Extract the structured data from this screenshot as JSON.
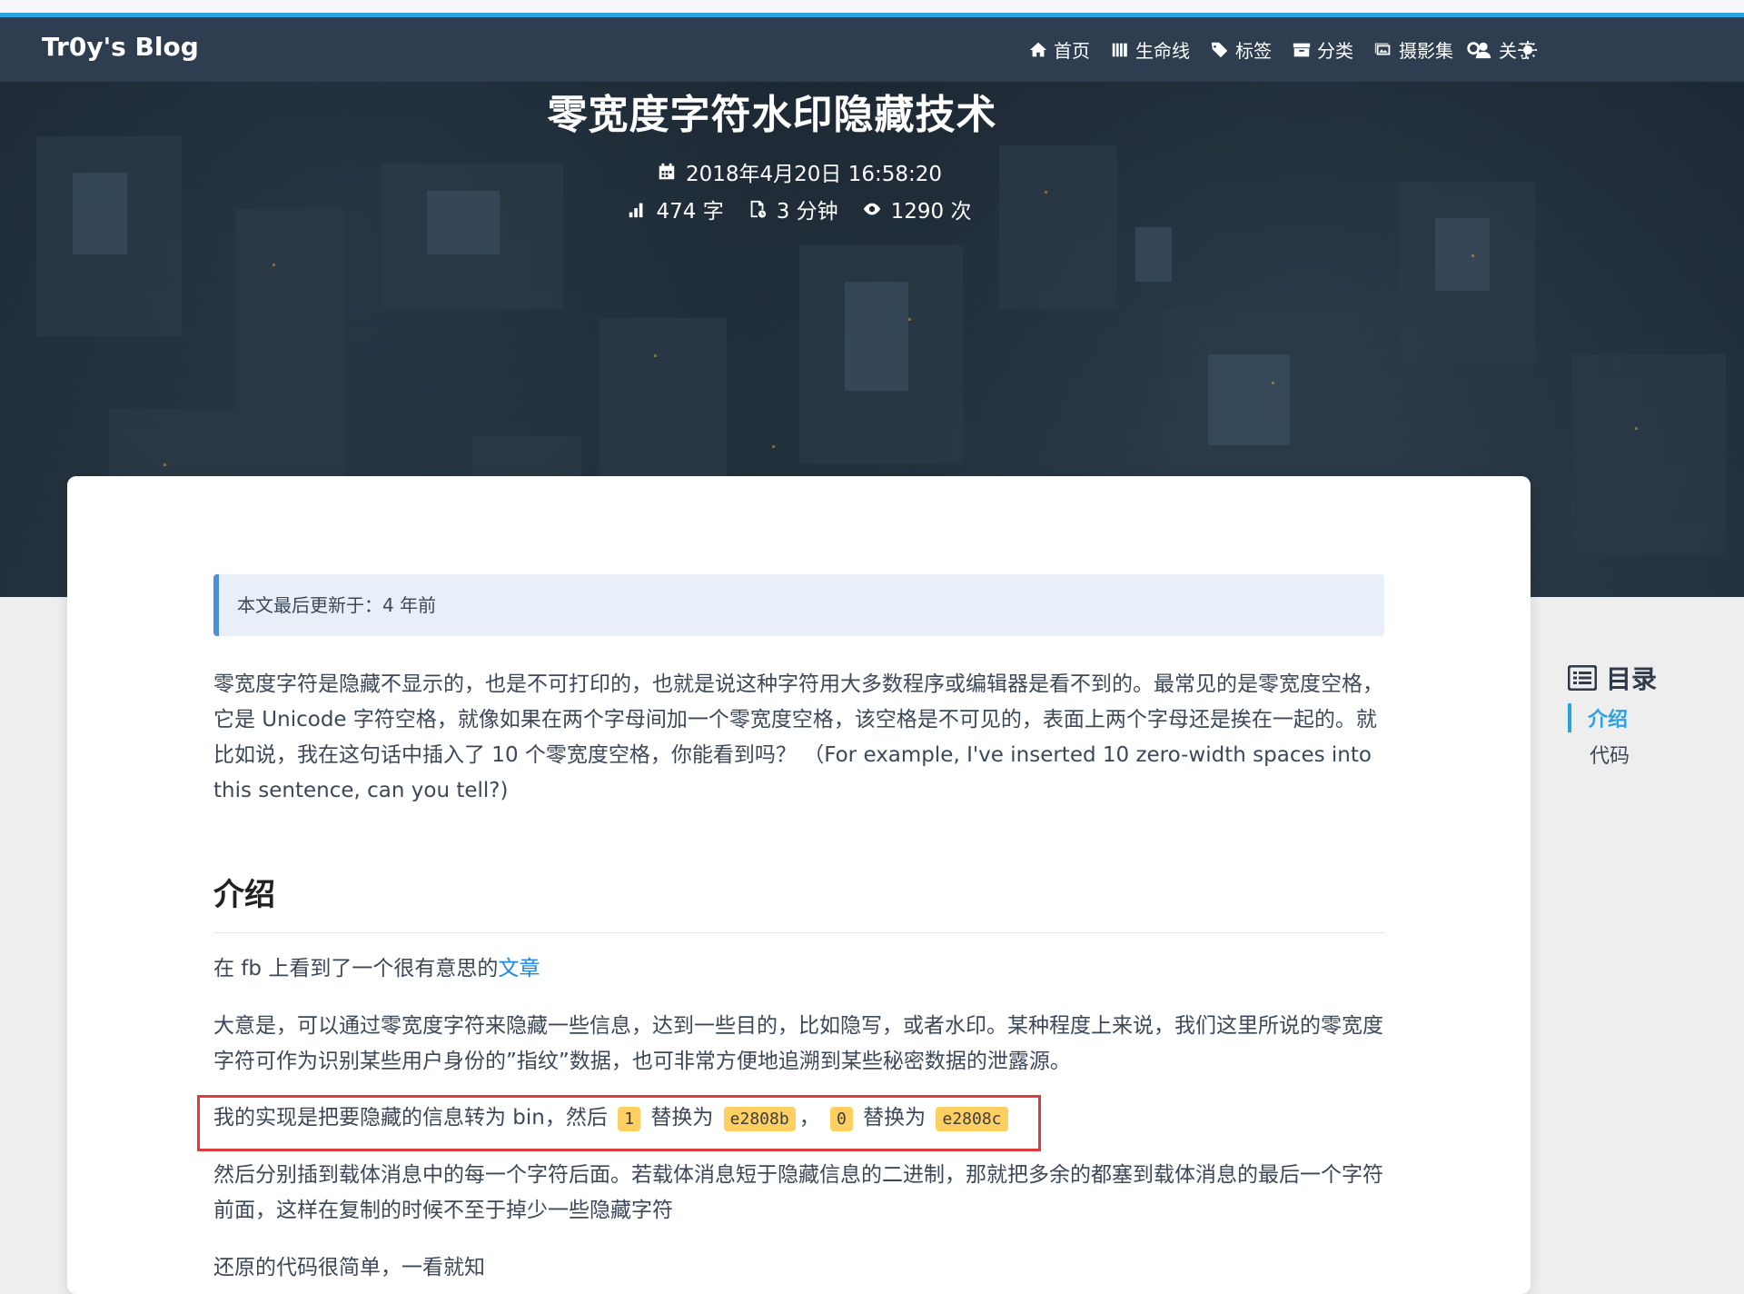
{
  "navbar": {
    "brand": "Tr0y's Blog",
    "items": [
      {
        "label": "首页",
        "icon": "home-icon"
      },
      {
        "label": "生命线",
        "icon": "archive-icon"
      },
      {
        "label": "标签",
        "icon": "tags-icon"
      },
      {
        "label": "分类",
        "icon": "folder-icon"
      },
      {
        "label": "摄影集",
        "icon": "images-icon"
      },
      {
        "label": "关于",
        "icon": "user-icon"
      }
    ],
    "search_icon": "search-icon",
    "theme_icon": "sun-icon"
  },
  "banner": {
    "title": "零宽度字符水印隐藏技术",
    "date": "2018年4月20日 16:58:20",
    "word_count": "474 字",
    "read_time": "3 分钟",
    "views": "1290 次"
  },
  "article": {
    "note": "本文最后更新于：4 年前",
    "intro_paragraph": "零宽度字符是隐藏不显示的，也是不可打印的，也就是说这种字符用大多数程序或编辑器是看不到的。最常见的是零宽度空格，它是 Unicode 字符空格，就像如果在两个字母间加一个零宽度空格，该空格是不可见的，表面上两个字母还是挨在一起的。就比如说，我在这句话中插入了 10 个零宽度空格，你能看到吗？ （For example, I've inserted 10 zero-width spaces into this sentence, can you tell?)",
    "section_heading": "介绍",
    "p1_text": "在 fb 上看到了一个很有意思的",
    "p1_link": "文章",
    "p2": "大意是，可以通过零宽度字符来隐藏一些信息，达到一些目的，比如隐写，或者水印。某种程度上来说，我们这里所说的零宽度字符可作为识别某些用户身份的”指纹”数据，也可非常方便地追溯到某些秘密数据的泄露源。",
    "p3_a": "我的实现是把要隐藏的信息转为 bin，然后",
    "p3_code1": "1",
    "p3_b": "替换为",
    "p3_code2": "e2808b",
    "p3_c": "，",
    "p3_code3": "0",
    "p3_d": "替换为",
    "p3_code4": "e2808c",
    "p4": "然后分别插到载体消息中的每一个字符后面。若载体消息短于隐藏信息的二进制，那就把多余的都塞到载体消息的最后一个字符前面，这样在复制的时候不至于掉少一些隐藏字符",
    "p5": "还原的代码很简单，一看就知"
  },
  "toc": {
    "title": "目录",
    "items": [
      {
        "label": "介绍",
        "active": true
      },
      {
        "label": "代码",
        "active": false
      }
    ]
  },
  "colors": {
    "navbar_bg": "#2e3d4f",
    "accent": "#29a3e0",
    "code_bg": "#ffcf62",
    "highlight_border": "#e03a3a"
  }
}
